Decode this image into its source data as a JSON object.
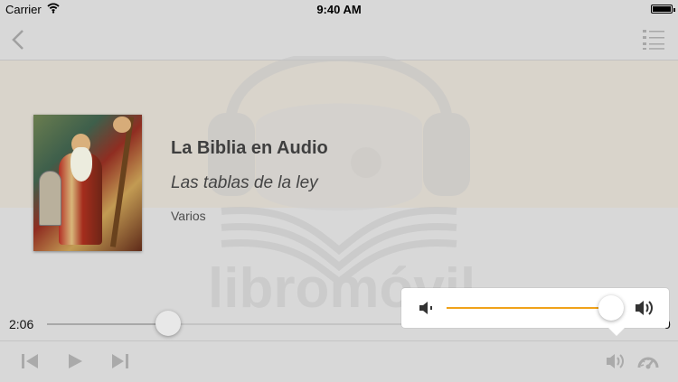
{
  "status": {
    "carrier": "Carrier",
    "time": "9:40 AM"
  },
  "book": {
    "title": "La Biblia en Audio",
    "subtitle": "Las tablas de la ley",
    "author": "Varios"
  },
  "player": {
    "current_time": "2:06",
    "remaining_time_fragment": "0",
    "progress": 0.2,
    "volume": 0.92
  },
  "watermark": {
    "brand": "libromóvil"
  },
  "icons": {
    "back": "chevron-left-icon",
    "menu": "list-icon",
    "previous": "skip-back-icon",
    "play": "play-icon",
    "next": "skip-forward-icon",
    "volume": "volume-icon",
    "speed": "speedometer-icon"
  },
  "colors": {
    "accent": "#f0a21a",
    "header_band": "#d9d4cb"
  }
}
